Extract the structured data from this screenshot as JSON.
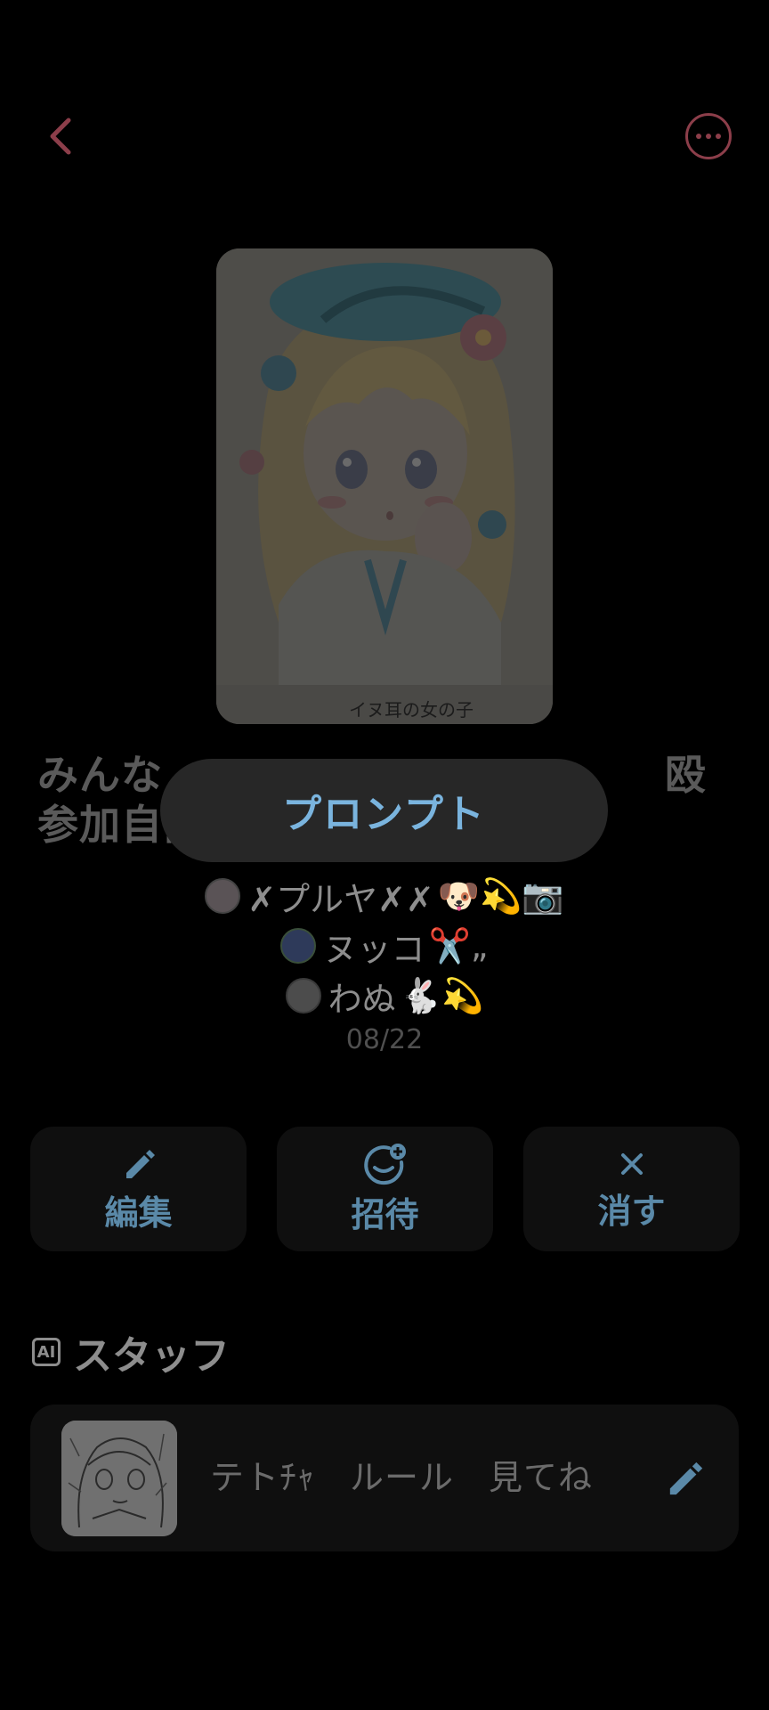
{
  "header": {
    "back_icon": "chevron-left-icon",
    "more_icon": "more-horizontal-icon",
    "accent_color": "#8c3e4a"
  },
  "cover": {
    "caption": "イヌ耳の女の子"
  },
  "group": {
    "title": "みんな　　　　　　　　　　　　殴　参加自由",
    "members": [
      {
        "name": "✗プルヤ✗✗",
        "emoji": "🐶💫📷"
      },
      {
        "name": "ヌッコ",
        "emoji": "✂️„"
      },
      {
        "name": "わぬ",
        "emoji": "🐇💫"
      }
    ],
    "date": "08/22"
  },
  "toast": {
    "label": "プロンプト"
  },
  "actions": [
    {
      "label": "編集",
      "icon": "pencil-icon"
    },
    {
      "label": "招待",
      "icon": "add-face-icon"
    },
    {
      "label": "消す",
      "icon": "close-icon"
    }
  ],
  "staff": {
    "section_badge": "AI",
    "section_title": "スタッフ",
    "item_text": "テトﾁｬ　ルール　見てね",
    "edit_icon": "pencil-icon"
  }
}
